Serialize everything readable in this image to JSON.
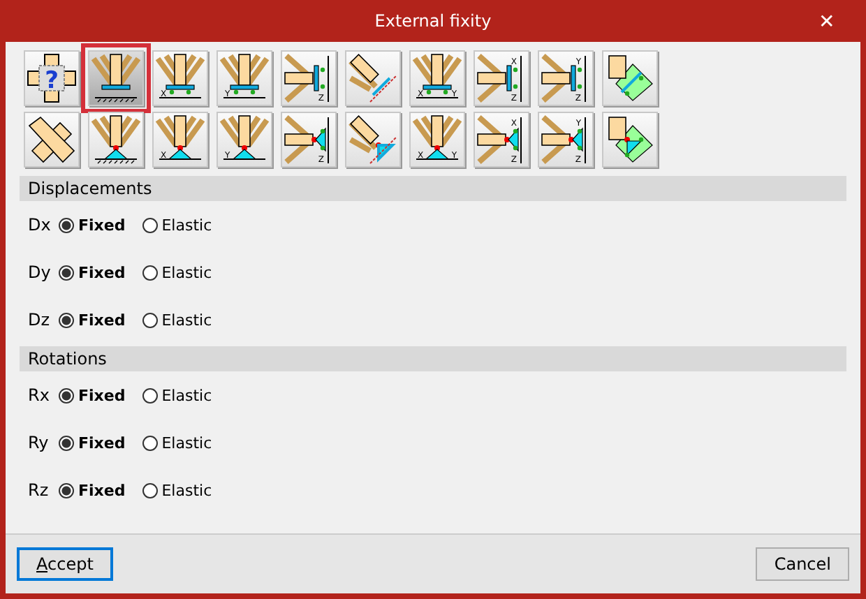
{
  "window": {
    "title": "External fixity",
    "close": "✕"
  },
  "supports": [
    {
      "kind": "unknown",
      "glyph": "?",
      "selected": false
    },
    {
      "kind": "base",
      "pinned": false,
      "selected": true
    },
    {
      "kind": "base",
      "pinned": false,
      "labels": [
        "X"
      ],
      "selected": false
    },
    {
      "kind": "base",
      "pinned": false,
      "labels": [
        "Y"
      ],
      "selected": false
    },
    {
      "kind": "side",
      "pinned": false,
      "labels": [
        "Z"
      ],
      "selected": false
    },
    {
      "kind": "inclined",
      "pinned": false,
      "selected": false
    },
    {
      "kind": "base",
      "pinned": false,
      "labels": [
        "X",
        "Y"
      ],
      "selected": false
    },
    {
      "kind": "side",
      "pinned": false,
      "labels": [
        "X",
        "Z"
      ],
      "selected": false
    },
    {
      "kind": "side",
      "pinned": false,
      "labels": [
        "Y",
        "Z"
      ],
      "selected": false
    },
    {
      "kind": "plane",
      "pinned": false,
      "selected": false
    },
    {
      "kind": "corner",
      "selected": false
    },
    {
      "kind": "base",
      "pinned": true,
      "selected": false
    },
    {
      "kind": "base",
      "pinned": true,
      "labels": [
        "X"
      ],
      "selected": false
    },
    {
      "kind": "base",
      "pinned": true,
      "labels": [
        "Y"
      ],
      "selected": false
    },
    {
      "kind": "side",
      "pinned": true,
      "labels": [
        "Z"
      ],
      "selected": false
    },
    {
      "kind": "inclined",
      "pinned": true,
      "selected": false
    },
    {
      "kind": "base",
      "pinned": true,
      "labels": [
        "X",
        "Y"
      ],
      "selected": false
    },
    {
      "kind": "side",
      "pinned": true,
      "labels": [
        "X",
        "Z"
      ],
      "selected": false
    },
    {
      "kind": "side",
      "pinned": true,
      "labels": [
        "Y",
        "Z"
      ],
      "selected": false
    },
    {
      "kind": "plane",
      "pinned": true,
      "selected": false
    }
  ],
  "sections": [
    {
      "title": "Displacements",
      "rows": [
        {
          "label": "Dx",
          "options": [
            {
              "label": "Fixed",
              "selected": true
            },
            {
              "label": "Elastic",
              "selected": false
            }
          ]
        },
        {
          "label": "Dy",
          "options": [
            {
              "label": "Fixed",
              "selected": true
            },
            {
              "label": "Elastic",
              "selected": false
            }
          ]
        },
        {
          "label": "Dz",
          "options": [
            {
              "label": "Fixed",
              "selected": true
            },
            {
              "label": "Elastic",
              "selected": false
            }
          ]
        }
      ]
    },
    {
      "title": "Rotations",
      "rows": [
        {
          "label": "Rx",
          "options": [
            {
              "label": "Fixed",
              "selected": true
            },
            {
              "label": "Elastic",
              "selected": false
            }
          ]
        },
        {
          "label": "Ry",
          "options": [
            {
              "label": "Fixed",
              "selected": true
            },
            {
              "label": "Elastic",
              "selected": false
            }
          ]
        },
        {
          "label": "Rz",
          "options": [
            {
              "label": "Fixed",
              "selected": true
            },
            {
              "label": "Elastic",
              "selected": false
            }
          ]
        }
      ]
    }
  ],
  "buttons": [
    {
      "label": "Accept",
      "kind": "default"
    },
    {
      "label": "Cancel",
      "kind": "normal"
    }
  ]
}
